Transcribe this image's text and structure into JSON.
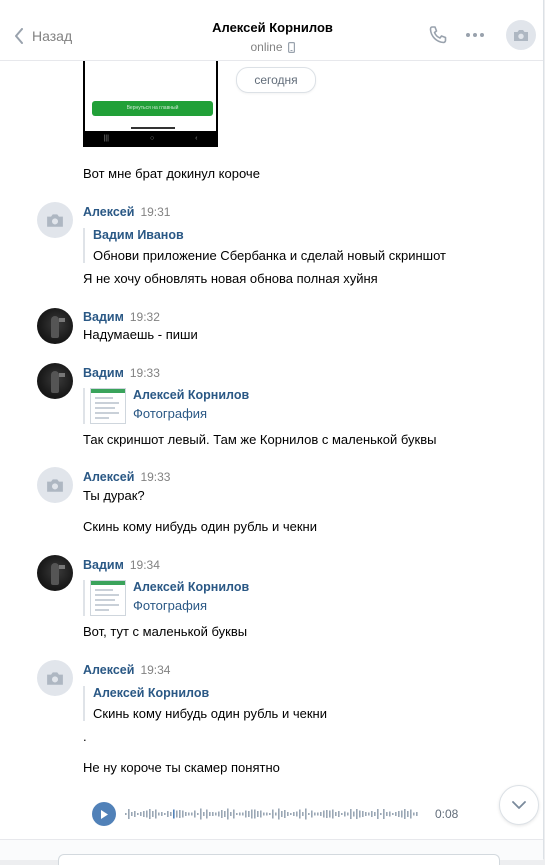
{
  "header": {
    "back_label": "Назад",
    "contact_name": "Алексей Корнилов",
    "status": "online"
  },
  "date_pill": "сегодня",
  "screenshot_button_text": "Вернуться на главный",
  "messages": [
    {
      "text": "Вот мне брат докинул короче"
    },
    {
      "author": "Алексей",
      "time": "19:31",
      "quote_author": "Вадим Иванов",
      "quote_text": "Обнови приложение Сбербанка и сделай новый скриншот",
      "text": "Я не хочу обновлять новая обнова полная хуйня"
    },
    {
      "author": "Вадим",
      "time": "19:32",
      "text": "Надумаешь - пиши"
    },
    {
      "author": "Вадим",
      "time": "19:33",
      "fwd_author": "Алексей Корнилов",
      "fwd_type": "Фотография",
      "text": "Так скриншот левый. Там же Корнилов с маленькой буквы"
    },
    {
      "author": "Алексей",
      "time": "19:33",
      "text": "Ты дурак?",
      "text2": "Скинь кому нибудь один рубль и чекни"
    },
    {
      "author": "Вадим",
      "time": "19:34",
      "fwd_author": "Алексей Корнилов",
      "fwd_type": "Фотография",
      "text": "Вот, тут с маленькой буквы"
    },
    {
      "author": "Алексей",
      "time": "19:34",
      "quote_author": "Алексей Корнилов",
      "quote_text": "Скинь кому нибудь один рубль и чекни",
      "text": ".",
      "text2": "Не ну короче ты скамер понятно"
    }
  ],
  "voice": {
    "duration": "0:08",
    "progress": 0.16
  },
  "colors": {
    "link": "#2a5885",
    "accent": "#5181b8",
    "muted": "#828282"
  },
  "icons": [
    "chevron-left-icon",
    "phone-icon",
    "more-icon",
    "camera-icon",
    "mobile-icon",
    "play-icon",
    "chevron-down-icon"
  ]
}
